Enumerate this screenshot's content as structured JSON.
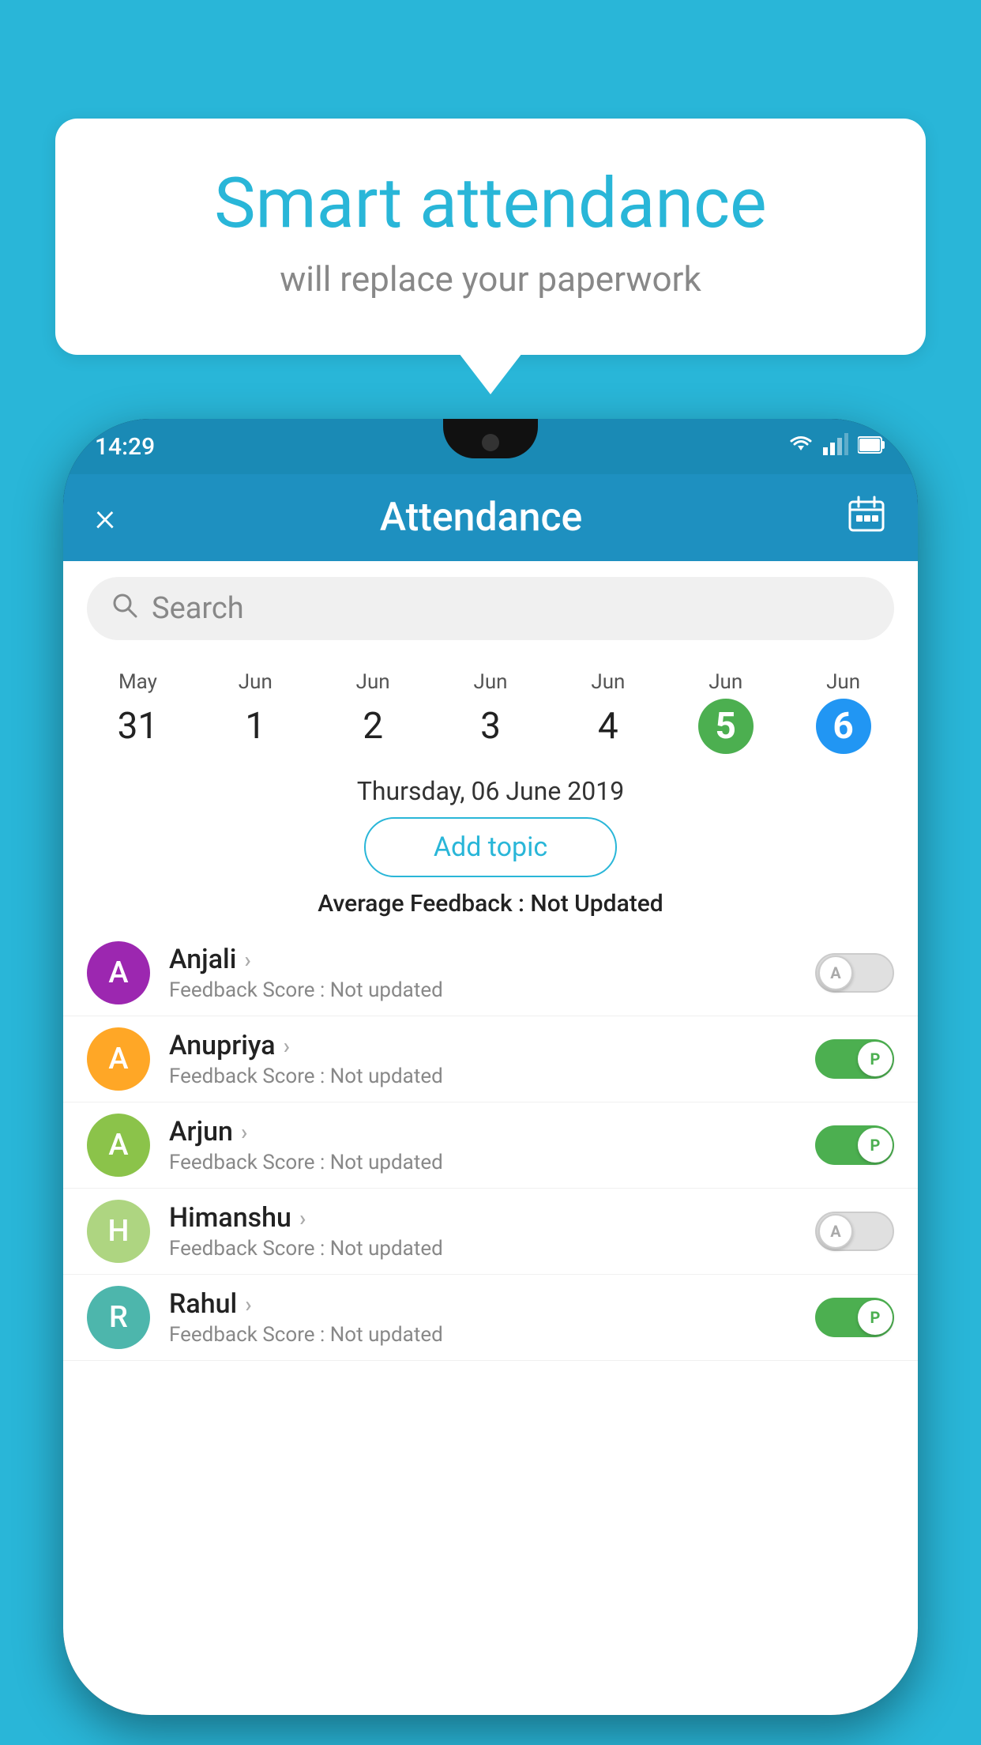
{
  "background_color": "#29b6d8",
  "bubble": {
    "title": "Smart attendance",
    "subtitle": "will replace your paperwork"
  },
  "phone": {
    "status_bar": {
      "time": "14:29",
      "icons": [
        "wifi",
        "signal",
        "battery"
      ]
    },
    "header": {
      "title": "Attendance",
      "close_label": "×",
      "calendar_icon": "📅"
    },
    "search": {
      "placeholder": "Search"
    },
    "dates": [
      {
        "month": "May",
        "day": "31",
        "style": "normal"
      },
      {
        "month": "Jun",
        "day": "1",
        "style": "normal"
      },
      {
        "month": "Jun",
        "day": "2",
        "style": "normal"
      },
      {
        "month": "Jun",
        "day": "3",
        "style": "normal"
      },
      {
        "month": "Jun",
        "day": "4",
        "style": "normal"
      },
      {
        "month": "Jun",
        "day": "5",
        "style": "green"
      },
      {
        "month": "Jun",
        "day": "6",
        "style": "blue"
      }
    ],
    "selected_date": "Thursday, 06 June 2019",
    "add_topic_label": "Add topic",
    "avg_feedback_label": "Average Feedback :",
    "avg_feedback_value": "Not Updated",
    "students": [
      {
        "name": "Anjali",
        "initial": "A",
        "avatar_color": "#9c27b0",
        "feedback_label": "Feedback Score :",
        "feedback_value": "Not updated",
        "toggle_state": "off",
        "toggle_label": "A"
      },
      {
        "name": "Anupriya",
        "initial": "A",
        "avatar_color": "#ffa726",
        "feedback_label": "Feedback Score :",
        "feedback_value": "Not updated",
        "toggle_state": "on",
        "toggle_label": "P"
      },
      {
        "name": "Arjun",
        "initial": "A",
        "avatar_color": "#8bc34a",
        "feedback_label": "Feedback Score :",
        "feedback_value": "Not updated",
        "toggle_state": "on",
        "toggle_label": "P"
      },
      {
        "name": "Himanshu",
        "initial": "H",
        "avatar_color": "#aed581",
        "feedback_label": "Feedback Score :",
        "feedback_value": "Not updated",
        "toggle_state": "off",
        "toggle_label": "A"
      },
      {
        "name": "Rahul",
        "initial": "R",
        "avatar_color": "#4db6ac",
        "feedback_label": "Feedback Score :",
        "feedback_value": "Not updated",
        "toggle_state": "on",
        "toggle_label": "P"
      }
    ]
  }
}
